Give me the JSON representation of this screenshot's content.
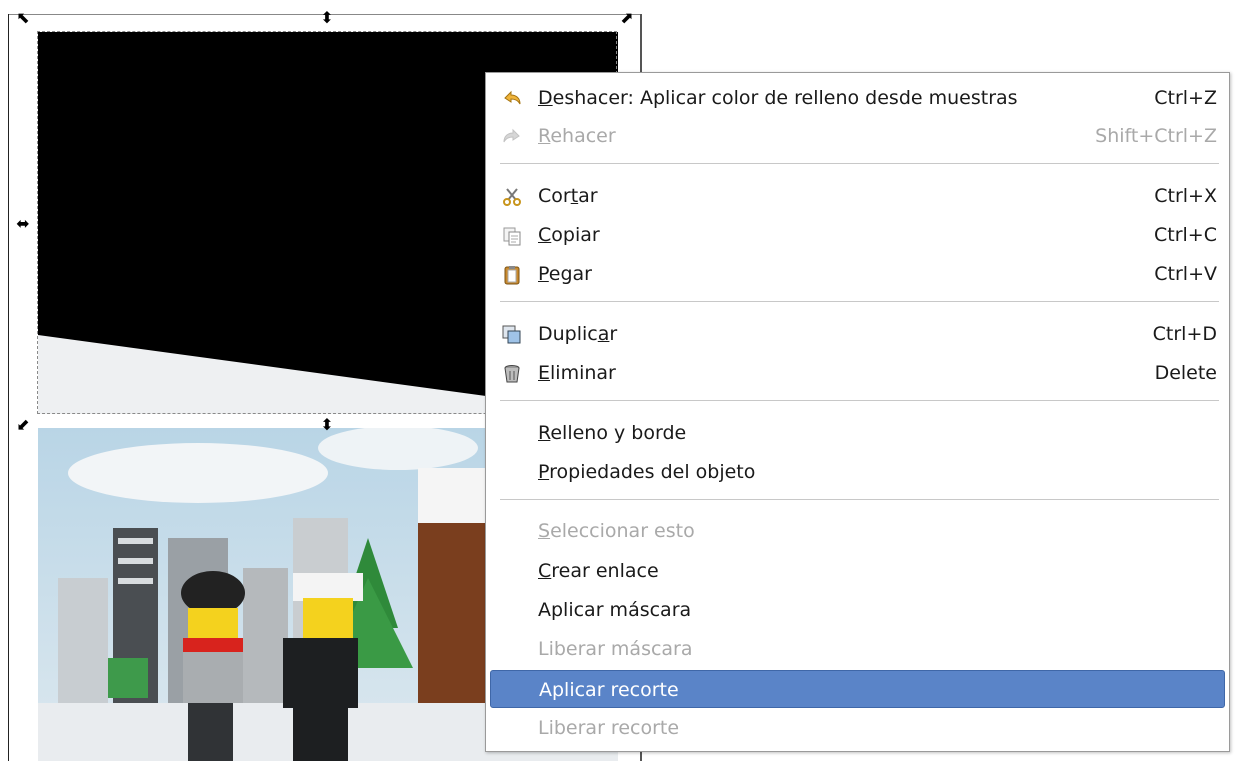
{
  "menu": {
    "items": [
      {
        "key": "undo",
        "pre": "",
        "u": "D",
        "post": "eshacer: Aplicar color de relleno desde muestras",
        "accel": "Ctrl+Z",
        "disabled": false,
        "icon": "undo-icon"
      },
      {
        "key": "redo",
        "pre": "",
        "u": "R",
        "post": "ehacer",
        "accel": "Shift+Ctrl+Z",
        "disabled": true,
        "icon": "redo-icon"
      },
      {
        "key": "cut",
        "pre": "Cor",
        "u": "t",
        "post": "ar",
        "accel": "Ctrl+X",
        "disabled": false,
        "icon": "scissors-icon"
      },
      {
        "key": "copy",
        "pre": "",
        "u": "C",
        "post": "opiar",
        "accel": "Ctrl+C",
        "disabled": false,
        "icon": "copy-icon"
      },
      {
        "key": "paste",
        "pre": "",
        "u": "P",
        "post": "egar",
        "accel": "Ctrl+V",
        "disabled": false,
        "icon": "clipboard-icon"
      },
      {
        "key": "duplicate",
        "pre": "Duplic",
        "u": "a",
        "post": "r",
        "accel": "Ctrl+D",
        "disabled": false,
        "icon": "duplicate-icon"
      },
      {
        "key": "delete",
        "pre": "",
        "u": "E",
        "post": "liminar",
        "accel": "Delete",
        "disabled": false,
        "icon": "trash-icon"
      },
      {
        "key": "fill-stroke",
        "pre": "",
        "u": "R",
        "post": "elleno y borde",
        "accel": "",
        "disabled": false,
        "icon": ""
      },
      {
        "key": "object-properties",
        "pre": "",
        "u": "P",
        "post": "ropiedades del objeto",
        "accel": "",
        "disabled": false,
        "icon": ""
      },
      {
        "key": "select-this",
        "pre": "",
        "u": "S",
        "post": "eleccionar esto",
        "accel": "",
        "disabled": true,
        "icon": ""
      },
      {
        "key": "create-link",
        "pre": "",
        "u": "C",
        "post": "rear enlace",
        "accel": "",
        "disabled": false,
        "icon": ""
      },
      {
        "key": "apply-mask",
        "pre": "Aplicar máscara",
        "u": "",
        "post": "",
        "accel": "",
        "disabled": false,
        "icon": ""
      },
      {
        "key": "release-mask",
        "pre": "Liberar máscara",
        "u": "",
        "post": "",
        "accel": "",
        "disabled": true,
        "icon": ""
      },
      {
        "key": "apply-clip",
        "pre": "Aplicar recorte",
        "u": "",
        "post": "",
        "accel": "",
        "disabled": false,
        "highlighted": true,
        "icon": ""
      },
      {
        "key": "release-clip",
        "pre": "Liberar recorte",
        "u": "",
        "post": "",
        "accel": "",
        "disabled": true,
        "icon": ""
      }
    ]
  },
  "colors": {
    "highlight": "#5a84c8",
    "disabled_text": "#a9a9a9",
    "text": "#1a1a1a"
  }
}
